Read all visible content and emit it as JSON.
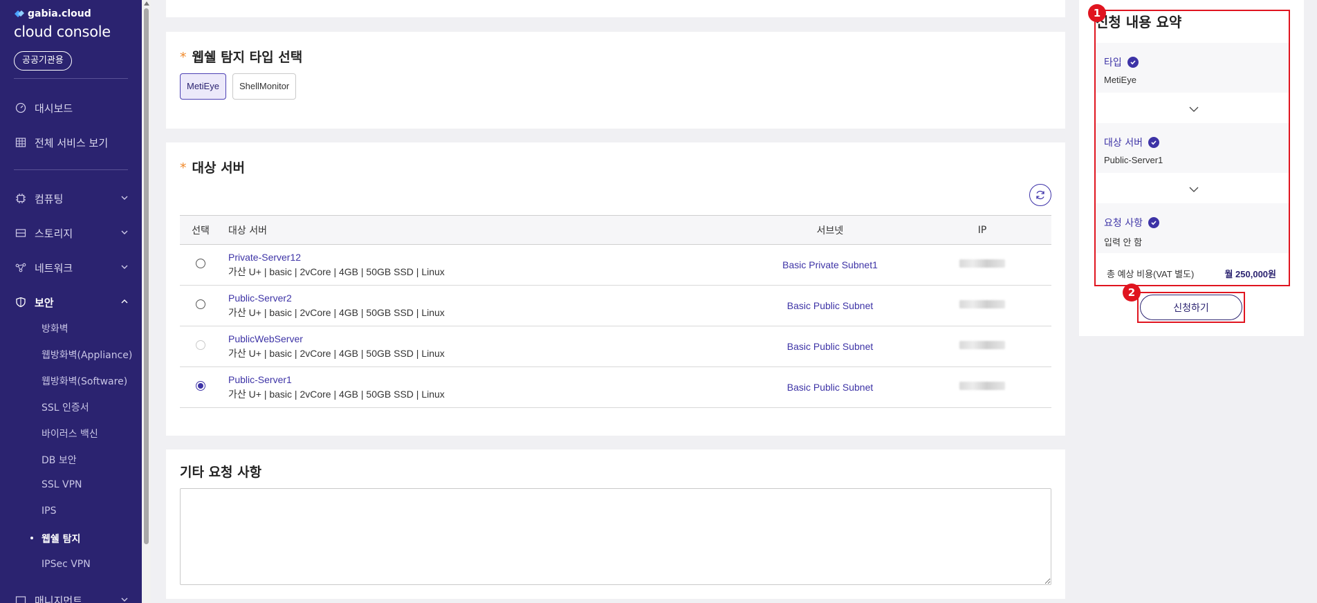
{
  "sidebar": {
    "brand_small": "gabia.cloud",
    "brand_big": "cloud console",
    "badge": "공공기관용",
    "top_items": [
      {
        "label": "대시보드",
        "icon": "dashboard-icon"
      },
      {
        "label": "전체 서비스 보기",
        "icon": "grid-icon"
      }
    ],
    "groups": [
      {
        "label": "컴퓨팅",
        "icon": "chip-icon"
      },
      {
        "label": "스토리지",
        "icon": "storage-icon"
      },
      {
        "label": "네트워크",
        "icon": "network-icon"
      },
      {
        "label": "보안",
        "icon": "shield-icon"
      }
    ],
    "security_items": [
      "방화벽",
      "웹방화벽(Appliance)",
      "웹방화벽(Software)",
      "SSL 인증서",
      "바이러스 백신",
      "DB 보안",
      "SSL VPN",
      "IPS",
      "웹쉘 탐지",
      "IPSec VPN"
    ],
    "bottom_group": "매니지먼트"
  },
  "webshell_card": {
    "required_mark": "*",
    "title": "웹쉘 탐지 타입 선택",
    "options": [
      "MetiEye",
      "ShellMonitor"
    ],
    "selected": "MetiEye"
  },
  "server_card": {
    "required_mark": "*",
    "title": "대상 서버",
    "columns": {
      "select": "선택",
      "name": "대상 서버",
      "subnet": "서브넷",
      "ip": "IP"
    },
    "rows": [
      {
        "name": "Private-Server12",
        "spec": "가산 U+ | basic | 2vCore | 4GB | 50GB SSD | Linux",
        "subnet": "Basic Private Subnet1",
        "state": "unchecked"
      },
      {
        "name": "Public-Server2",
        "spec": "가산 U+ | basic | 2vCore | 4GB | 50GB SSD | Linux",
        "subnet": "Basic Public Subnet",
        "state": "unchecked"
      },
      {
        "name": "PublicWebServer",
        "spec": "가산 U+ | basic | 2vCore | 4GB | 50GB SSD | Linux",
        "subnet": "Basic Public Subnet",
        "state": "disabled"
      },
      {
        "name": "Public-Server1",
        "spec": "가산 U+ | basic | 2vCore | 4GB | 50GB SSD | Linux",
        "subnet": "Basic Public Subnet",
        "state": "checked"
      }
    ]
  },
  "etc_card": {
    "title": "기타 요청 사항",
    "value": ""
  },
  "summary": {
    "title": "신청 내용 요약",
    "sections": [
      {
        "label": "타입",
        "value": "MetiEye"
      },
      {
        "label": "대상 서버",
        "value": "Public-Server1"
      },
      {
        "label": "요청 사항",
        "value": "입력 안 함"
      }
    ],
    "cost_label": "총 예상 비용(VAT 별도)",
    "cost_value": "월 250,000원",
    "apply_label": "신청하기",
    "markers": [
      "1",
      "2"
    ]
  },
  "colors": {
    "sidebar": "#2b2370",
    "accent": "#3d33a6",
    "highlight": "#e0141f",
    "required": "#f08a2c"
  }
}
